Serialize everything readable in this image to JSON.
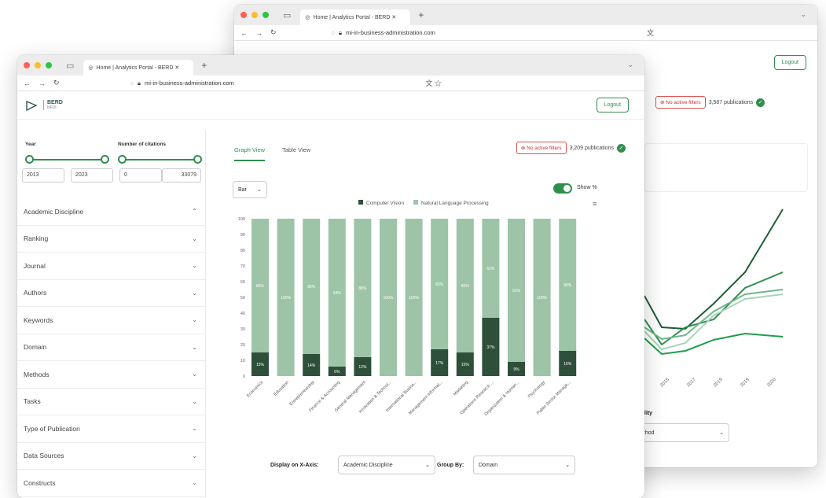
{
  "browser": {
    "tab_title": "Home | Analytics Portal - BERD ✕",
    "url": "mi-in-business-administration.com"
  },
  "back_window": {
    "tab_title": "Home | Analytics Portal - BERD ✕",
    "logout": "Logout",
    "filter_pill": "⊗ No active filters",
    "pub_count": "3,587 publications",
    "x_ticks": [
      "2015",
      "2017",
      "2019",
      "2019",
      "2020"
    ],
    "select_label": "ality",
    "select_value": "ethod",
    "line_colors": [
      "#1f5c36",
      "#2f8f4e",
      "#6db98a",
      "#a8d5b8",
      "#1e9e4a"
    ]
  },
  "header": {
    "brand": "BERD",
    "brand_sub": "NFDI",
    "logout": "Logout"
  },
  "sidebar": {
    "year_label": "Year",
    "year_from": "2013",
    "year_to": "2023",
    "citations_label": "Number of citations",
    "cit_from": "0",
    "cit_to": "33079",
    "facets": [
      {
        "label": "Academic Discipline",
        "open": true
      },
      {
        "label": "Ranking"
      },
      {
        "label": "Journal"
      },
      {
        "label": "Authors"
      },
      {
        "label": "Keywords"
      },
      {
        "label": "Domain"
      },
      {
        "label": "Methods"
      },
      {
        "label": "Tasks"
      },
      {
        "label": "Type of Publication"
      },
      {
        "label": "Data Sources"
      },
      {
        "label": "Constructs"
      }
    ]
  },
  "main": {
    "tabs": [
      "Graph View",
      "Table View"
    ],
    "filter_pill": "⊗ No active filters",
    "pub_count": "3,209 publications",
    "chart_type_select": "Bar",
    "show_pct_label": "Show %",
    "x_axis_label": "Display on X-Axis:",
    "x_axis_value": "Academic Discipline",
    "group_by_label": "Group By:",
    "group_by_value": "Domain"
  },
  "colors": {
    "accent": "#2f8f4e",
    "series_dark": "#2e4f3a",
    "series_light": "#9dc4a7"
  },
  "chart_data": {
    "type": "bar",
    "stacked": true,
    "categories": [
      "Economics",
      "Education",
      "Entrepreneurship",
      "Finance & Accounting",
      "General Management",
      "Innovation & Technol...",
      "International Busine...",
      "Management Informat...",
      "Marketing",
      "Operations Research ...",
      "Organization & Human...",
      "Psychology",
      "Public Sector Manage..."
    ],
    "series": [
      {
        "name": "Computer Vision",
        "values": [
          15,
          0,
          14,
          6,
          12,
          0,
          0,
          17,
          15,
          37,
          9,
          0,
          16
        ]
      },
      {
        "name": "Natural Language Processing",
        "values": [
          85,
          100,
          86,
          94,
          88,
          100,
          100,
          83,
          85,
          63,
          91,
          100,
          84
        ]
      }
    ],
    "label_texts": {
      "Computer Vision": [
        "15%",
        "",
        "14%",
        "6%",
        "12%",
        "",
        "",
        "17%",
        "15%",
        "37%",
        "9%",
        "",
        "16%"
      ],
      "Natural Language Processing": [
        "85%",
        "100%",
        "86%",
        "94%",
        "88%",
        "100%",
        "100%",
        "83%",
        "85%",
        "63%",
        "91%",
        "100%",
        "84%"
      ]
    },
    "ylim": [
      0,
      100
    ],
    "yticks": [
      0,
      10,
      20,
      30,
      40,
      50,
      60,
      70,
      80,
      90,
      100
    ],
    "legend": "top",
    "grid": false
  }
}
